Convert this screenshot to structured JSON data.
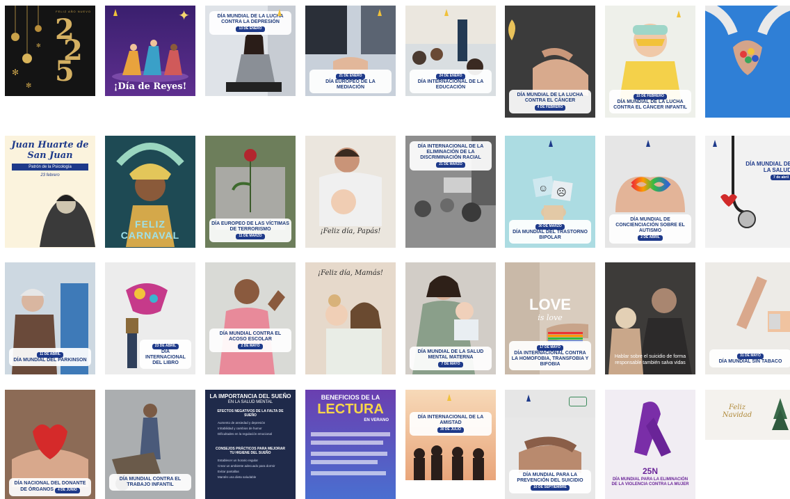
{
  "tiles": [
    {
      "id": "t1",
      "top": "FELIZ AÑO NUEVO",
      "num_a": "2",
      "num_b": "2",
      "num_c": "5"
    },
    {
      "id": "t2",
      "caption": "¡Día de Reyes!"
    },
    {
      "id": "t3",
      "caption": "DÍA MUNDIAL DE LA LUCHA CONTRA LA DEPRESIÓN",
      "date": "13 de enero"
    },
    {
      "id": "t4",
      "caption": "DÍA EUROPEO DE LA MEDIACIÓN",
      "date": "21 de enero"
    },
    {
      "id": "t5",
      "caption": "DÍA INTERNACIONAL DE LA educación",
      "date": "24 de enero"
    },
    {
      "id": "t6",
      "caption": "DÍA MUNDIAL de la Lucha Contra el CÁNCER",
      "date": "4 de febrero"
    },
    {
      "id": "t7",
      "caption": "DÍA MUNDIAL DE LA LUCHA CONTRA EL CÁNCER INFANTIL",
      "date": "15 de febrero"
    },
    {
      "id": "t8",
      "caption": ""
    },
    {
      "id": "t9",
      "title": "Juan Huarte de San Juan",
      "subtitle": "Patrón de la Psicología",
      "date": "23 febrero"
    },
    {
      "id": "t10",
      "caption": "FELIZ CARNAVAL"
    },
    {
      "id": "t11",
      "caption": "DÍA EUROPEO DE LAS VÍCTIMAS DE TERRORISMO",
      "date": "11 de marzo"
    },
    {
      "id": "t12",
      "caption": "¡Feliz día, Papás!"
    },
    {
      "id": "t13",
      "caption": "DÍA INTERNACIONAL DE LA ELIMINACIÓN DE LA DISCRIMINACIÓN RACIAL",
      "date": "21 de marzo"
    },
    {
      "id": "t14",
      "caption": "DÍA MUNDIAL DEL TRASTORNO BIPOLAR",
      "date": "30 de marzo"
    },
    {
      "id": "t15",
      "caption": "DÍA MUNDIAL DE CONCIENCIACIÓN SOBRE EL AUTISMO",
      "date": "2 de abril"
    },
    {
      "id": "t16",
      "caption": "DÍA MUNDIAL DE LA SALUD",
      "date": "7 de abril"
    },
    {
      "id": "t17",
      "caption": "DÍA MUNDIAL DEL PARKINSON",
      "date": "11 de abril"
    },
    {
      "id": "t18",
      "caption": "DÍA INTERNACIONAL DEL libro",
      "date": "23 de abril"
    },
    {
      "id": "t19",
      "caption": "DÍA MUNDIAL CONTRA EL ACOSO ESCOLAR",
      "date": "2 de mayo"
    },
    {
      "id": "t20",
      "caption": "¡Feliz día, Mamás!"
    },
    {
      "id": "t21",
      "caption": "DÍA MUNDIAL DE LA SALUD MENTAL MATERNA",
      "date": "7 de mayo"
    },
    {
      "id": "t22",
      "caption": "DÍA INTERNACIONAL CONTRA LA HOMOFOBIA, TRANSFOBIA Y BIFOBIA",
      "date": "17 de mayo",
      "big": "LOVE",
      "small": "is love"
    },
    {
      "id": "t23",
      "caption": "Hablar sobre el suicidio de forma responsable también salva vidas"
    },
    {
      "id": "t24",
      "caption": "DÍA MUNDIAL SIN TABACO",
      "date": "31 de mayo"
    },
    {
      "id": "t25",
      "caption": "Día Nacional del Donante de ÓRGANOS",
      "date": "4 de junio"
    },
    {
      "id": "t26",
      "caption": "Día Mundial Contra el TRABAJO INFANTIL"
    },
    {
      "id": "t27",
      "heading": "LA IMPORTANCIA DEL SUEÑO",
      "sub": "EN LA SALUD MENTAL",
      "h2": "EFECTOS NEGATIVOS DE LA FALTA DE SUEÑO",
      "items": [
        "Aumento de ansiedad y depresión",
        "Irritabilidad y cambios de humor",
        "Dificultades en la regulación emocional"
      ],
      "h3": "CONSEJOS PRÁCTICOS PARA MEJORAR TU HIGIENE DEL SUEÑO",
      "items2": [
        "Establecer un horario regular",
        "Crear un ambiente adecuado para dormir",
        "Evitar pantallas",
        "Mantén una dieta saludable"
      ]
    },
    {
      "id": "t28",
      "heading": "BENEFICIOS DE LA",
      "big": "LECTURA",
      "sub": "EN VERANO"
    },
    {
      "id": "t29",
      "caption": "DÍA INTERNACIONAL DE LA AMISTAD",
      "date": "30 de julio"
    },
    {
      "id": "t30",
      "caption": "DÍA MUNDIAL PARA LA PREVENCIÓN DEL SUICIDIO",
      "date": "10 de septiembre"
    },
    {
      "id": "t31",
      "big": "25N",
      "caption": "DÍA MUNDIAL PARA LA ELIMINACIÓN DE LA VIOLENCIA CONTRA LA MUJER"
    },
    {
      "id": "t32",
      "caption": "Feliz Navidad"
    }
  ]
}
